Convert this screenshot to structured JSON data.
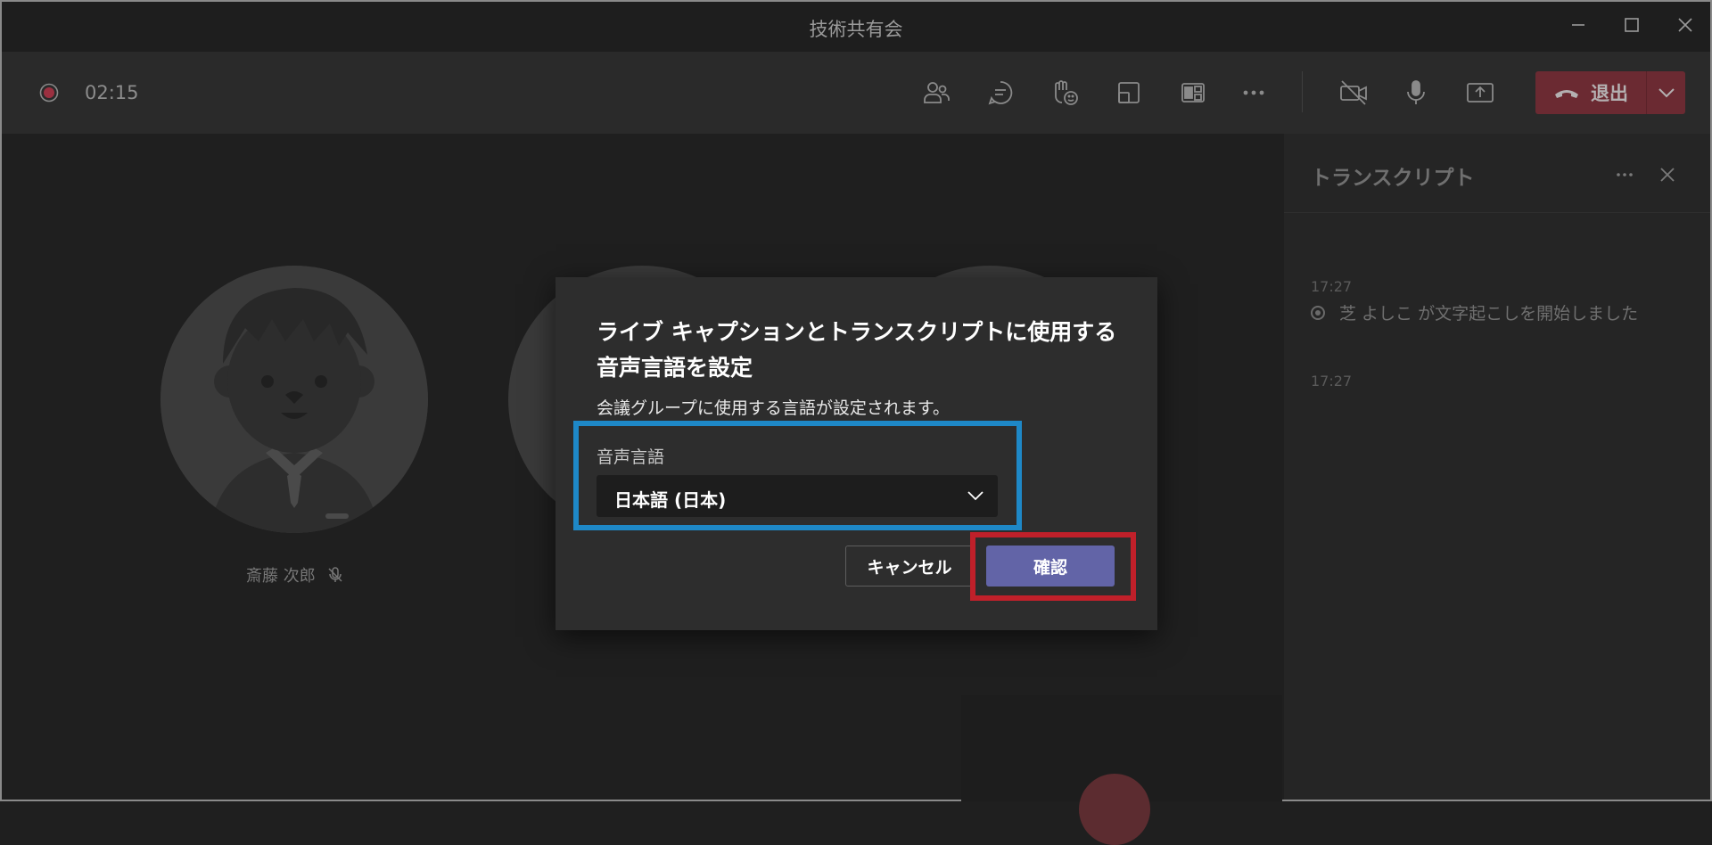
{
  "window": {
    "title": "技術共有会",
    "controls": [
      "minimize-icon",
      "maximize-icon",
      "close-icon"
    ]
  },
  "toolbar": {
    "recording_icon": "recording-icon",
    "timer": "02:15",
    "icons": [
      "participants-icon",
      "chat-icon",
      "raise-hand-icon",
      "rooms-icon",
      "apps-icon",
      "more-icon",
      "camera-off-icon",
      "mic-icon",
      "share-screen-icon"
    ],
    "leave_label": "退出",
    "leave_color": "#6b2a32"
  },
  "stage": {
    "participant_name": "斎藤 次郎",
    "muted_icon": "mic-off-icon"
  },
  "transcript": {
    "title": "トランスクリプト",
    "entries": [
      {
        "time": "17:27",
        "text": "芝 よしこ が文字起こしを開始しました"
      },
      {
        "time": "17:27",
        "text": ""
      }
    ]
  },
  "dialog": {
    "title": "ライブ キャプションとトランスクリプトに使用する音声言語を設定",
    "subtitle": "会議グループに使用する言語が設定されます。",
    "field_label": "音声言語",
    "selected_language": "日本語 (日本)",
    "cancel_label": "キャンセル",
    "confirm_label": "確認",
    "confirm_color": "#6264a7"
  },
  "annotations": {
    "blue_box_color": "#1e88c7",
    "red_box_color": "#c0202a"
  }
}
